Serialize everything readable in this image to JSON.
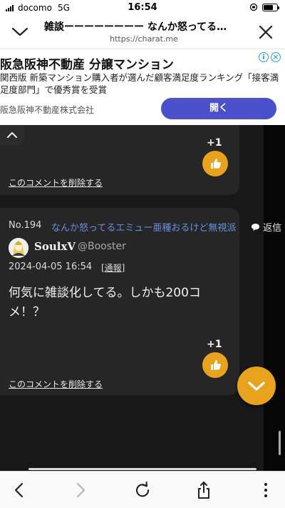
{
  "status": {
    "carrier": "docomo",
    "network": "5G",
    "time": "16:54"
  },
  "browser": {
    "page_title": "雑談ーーーーーーーー なんか怒ってる…",
    "host": "https://charat.me"
  },
  "ad": {
    "title": "阪急阪神不動産 分譲マンション",
    "description": "関西版 新築マンション購入者が選んだ顧客満足度ランキング「接客満足度部門」で優秀賞を受賞",
    "sponsor": "阪急阪神不動産株式会社",
    "cta": "開く",
    "info_icon": "i",
    "close_icon": "×"
  },
  "comments": [
    {
      "likes": "+1",
      "delete_label": "このコメントを削除する"
    },
    {
      "number": "No.194",
      "thread": "なんか怒ってるエミュー亜種おるけど無視派",
      "reply_label": "返信",
      "username": "SoulxV",
      "user_id": "@Booster",
      "date": "2024-04-05 16:54",
      "report_label": "[通報]",
      "text": "何気に雑談化してる。しかも200コメ！？",
      "likes": "+1",
      "delete_label": "このコメントを削除する"
    }
  ],
  "colors": {
    "accent": "#e9a21c",
    "link": "#6a8fe0",
    "cta": "#4a4fce",
    "background": "#181818"
  }
}
